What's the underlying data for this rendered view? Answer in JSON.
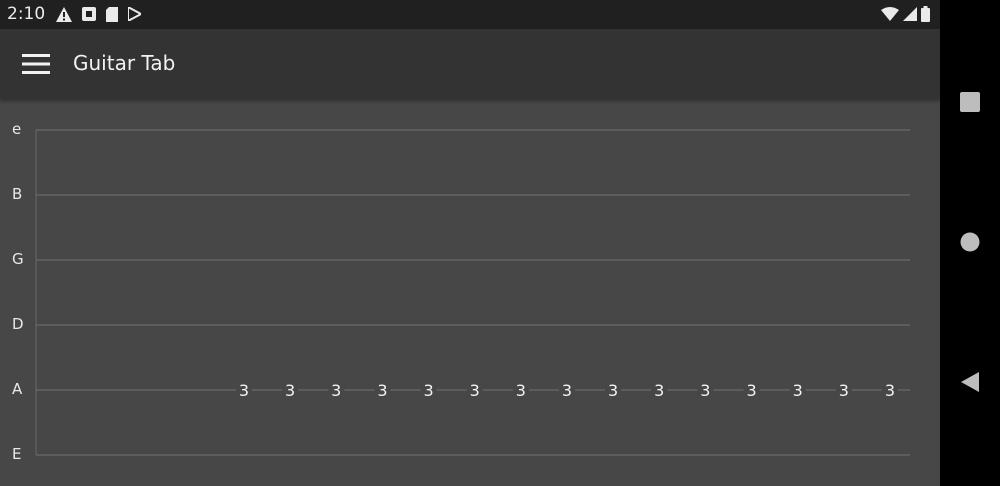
{
  "status_bar": {
    "time": "2:10",
    "left_icons": [
      "warning-icon",
      "notification-box-icon",
      "sd-card-icon",
      "play-store-icon"
    ],
    "right_icons": [
      "wifi-icon",
      "signal-icon",
      "battery-icon"
    ]
  },
  "app_bar": {
    "menu_icon": "hamburger-menu-icon",
    "title": "Guitar Tab"
  },
  "tab": {
    "strings": [
      {
        "name": "e",
        "notes": []
      },
      {
        "name": "B",
        "notes": []
      },
      {
        "name": "G",
        "notes": []
      },
      {
        "name": "D",
        "notes": []
      },
      {
        "name": "A",
        "notes": [
          "3",
          "3",
          "3",
          "3",
          "3",
          "3",
          "3",
          "3",
          "3",
          "3",
          "3",
          "3",
          "3",
          "3",
          "3"
        ]
      },
      {
        "name": "E",
        "notes": []
      }
    ]
  },
  "nav_bar": {
    "buttons": [
      "recents-square-icon",
      "home-circle-icon",
      "back-triangle-icon"
    ]
  },
  "colors": {
    "background": "#474747",
    "app_bar": "#333333",
    "status_bar": "#202020",
    "text": "#f2f2f2",
    "tab_line": "#6a6a6a",
    "nav_icon": "#bdbdbd"
  }
}
